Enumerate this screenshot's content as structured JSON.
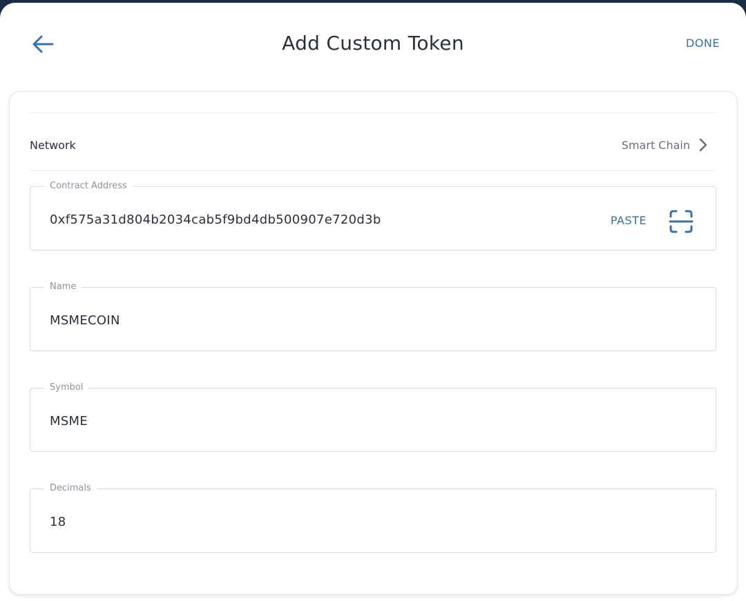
{
  "header": {
    "title": "Add Custom Token",
    "done_label": "DONE"
  },
  "network": {
    "label": "Network",
    "value": "Smart Chain"
  },
  "fields": {
    "contract_address": {
      "label": "Contract Address",
      "value": "0xf575a31d804b2034cab5f9bd4db500907e720d3b",
      "paste_label": "PASTE"
    },
    "name": {
      "label": "Name",
      "value": "MSMECOIN"
    },
    "symbol": {
      "label": "Symbol",
      "value": "MSME"
    },
    "decimals": {
      "label": "Decimals",
      "value": "18"
    }
  },
  "icons": {
    "back": "arrow-left-icon",
    "network_chevron": "chevron-right-icon",
    "scan": "qr-scan-icon"
  },
  "colors": {
    "accent": "#3a6fa8",
    "text": "#2b2f38",
    "muted": "#8f939b",
    "top_bar": "#1a2b44"
  }
}
